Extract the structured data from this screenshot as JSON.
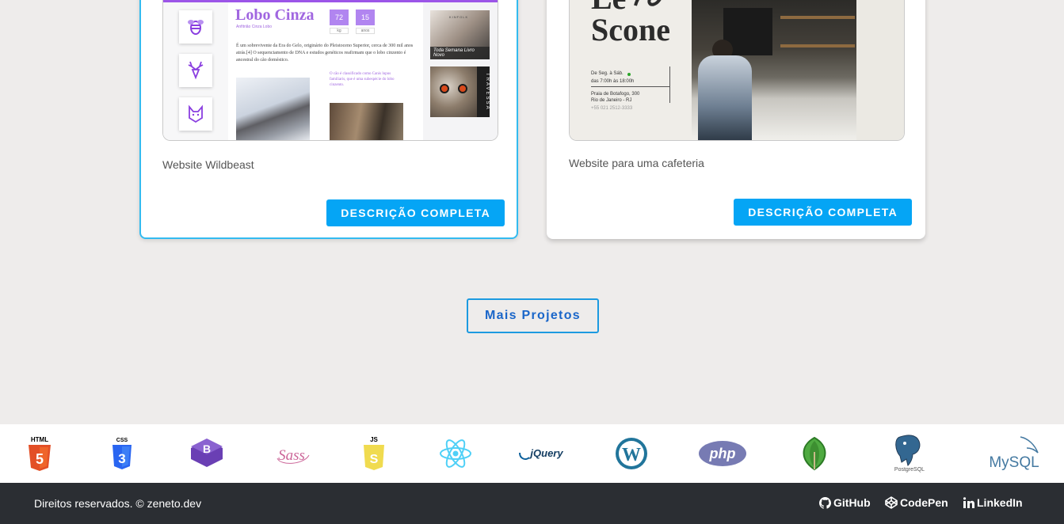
{
  "projects": [
    {
      "caption": "Website Wildbeast",
      "button_label": "DESCRIÇÃO COMPLETA",
      "thumbnail": {
        "title": "Lobo Cinza",
        "subtitle": "Anfitrião Cinza Lobo",
        "stats": [
          {
            "value": "72",
            "label": "kg"
          },
          {
            "value": "15",
            "label": "anos"
          }
        ],
        "body_text": "É um sobrevivente da Era do Gelo, originário do Pleistoceno Superior, cerca de 300 mil anos atrás.[4] O sequenciamento de DNA e estudos genéticos reafirmam que o lobo cinzento é ancestral do cão doméstico.",
        "purple_text": "O cão é classificado como Canis lupus familiaris, que é uma subespécie do lobo cinzento.",
        "side_caption": "Toda Semana Livro Novo",
        "side_label": "KINFOLK",
        "strip_label": "TRAVESSA"
      }
    },
    {
      "caption": "Website para uma cafeteria",
      "button_label": "DESCRIÇÃO COMPLETA",
      "thumbnail": {
        "title_line1": "Le",
        "title_line2": "Scone",
        "hours_line1": "De Seg. à Sáb.",
        "hours_line2": "das 7:00h às 18:00h",
        "address_line1": "Praia de Botafogo, 300",
        "address_line2": "Rio de Janeiro - RJ",
        "phone": "+55 021 2512-3333"
      }
    }
  ],
  "more_projects_label": "Mais Projetos",
  "tech_logos": [
    {
      "icon": "html5-icon",
      "label": "HTML",
      "color": "#e34f26"
    },
    {
      "icon": "css3-icon",
      "label": "CSS",
      "color": "#2965f1"
    },
    {
      "icon": "bootstrap-icon",
      "label": "B",
      "color": "#7952b3"
    },
    {
      "icon": "sass-icon",
      "label": "Sass",
      "color": "#cc6699"
    },
    {
      "icon": "javascript-icon",
      "label": "JS",
      "color": "#f0db4f"
    },
    {
      "icon": "react-icon",
      "label": "",
      "color": "#4fd0f7"
    },
    {
      "icon": "jquery-icon",
      "label": "jQuery",
      "color": "#0a5e9a"
    },
    {
      "icon": "wordpress-icon",
      "label": "",
      "color": "#21759b"
    },
    {
      "icon": "php-icon",
      "label": "php",
      "color": "#777bb3"
    },
    {
      "icon": "mongodb-icon",
      "label": "",
      "color": "#4faa41"
    },
    {
      "icon": "postgresql-icon",
      "label": "PostgreSQL",
      "color": "#336791"
    },
    {
      "icon": "mysql-icon",
      "label": "MySQL",
      "color": "#4479a1"
    }
  ],
  "footer": {
    "copyright": "Direitos reservados. © zeneto.dev",
    "links": [
      {
        "icon": "github-icon",
        "label": "GitHub"
      },
      {
        "icon": "codepen-icon",
        "label": "CodePen"
      },
      {
        "icon": "linkedin-icon",
        "label": "LinkedIn"
      }
    ]
  },
  "colors": {
    "accent": "#05a5f5",
    "card_highlight": "#33bbf0",
    "footer_bg": "#2b2e33",
    "page_bg": "#eeeceb"
  }
}
